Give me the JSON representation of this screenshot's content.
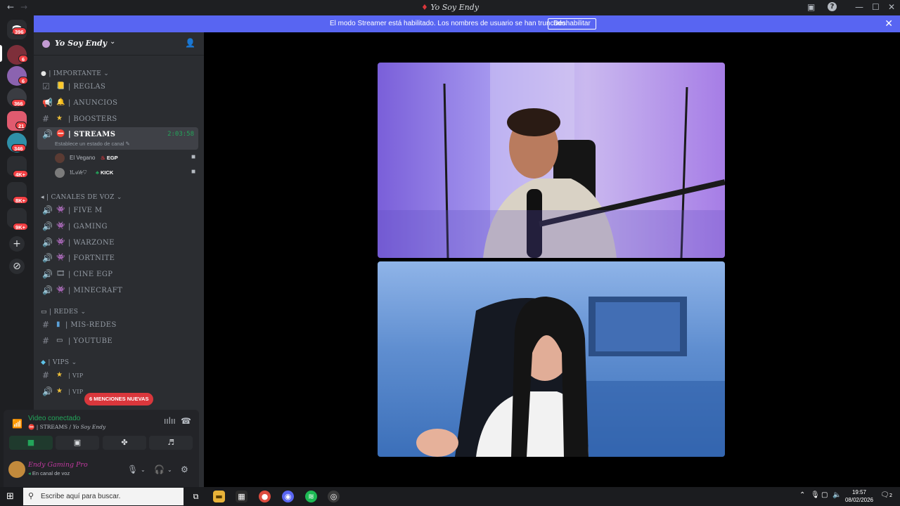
{
  "window": {
    "title": "Yo Soy Endy",
    "back_icon": "←",
    "forward_icon": "→",
    "minimize": "—",
    "maximize": "☐",
    "close": "✕",
    "help": "?"
  },
  "banner": {
    "message": "El modo Streamer está habilitado. Los nombres de usuario se han truncado.",
    "button": "Deshabilitar",
    "close": "✕"
  },
  "servers": {
    "badges": [
      "396",
      "6",
      "6",
      "366",
      "21",
      "346",
      "4K+",
      "8K+",
      "9K+"
    ],
    "add_icon": "+",
    "explore_icon": "⊘"
  },
  "guild": {
    "name": "Yo Soy Endy",
    "chevron": "⌄"
  },
  "categories": [
    {
      "label": "| IMPORTANTE",
      "chev": "⌄"
    },
    {
      "label": "| CANALES DE VOZ",
      "chev": "⌄"
    },
    {
      "label": "| REDES",
      "chev": "⌄"
    },
    {
      "label": "| VIPS",
      "chev": "⌄"
    }
  ],
  "channels": {
    "reglas": "| REGLAS",
    "anuncios": "| ANUNCIOS",
    "boosters": "| BOOSTERS",
    "streams": "| STREAMS",
    "streams_timer": "2:03:58",
    "streams_status": "Establece un estado de canal",
    "fivem": "| FIVE M",
    "gaming": "|  GAMING",
    "warzone": "| WARZONE",
    "fortnite": "| FORTNITE",
    "cine": "| CINE EGP",
    "minecraft": "| MINECRAFT",
    "misredes": "| MIS-REDES",
    "youtube": "| YOUTUBE",
    "vip1": "| VIP",
    "vip2": "| VIP"
  },
  "voice_users": [
    {
      "name": "El Vegano",
      "tag": "EGP"
    },
    {
      "name": "𝔘𝒜𝓁𝑒♡",
      "tag": "KICK"
    }
  ],
  "mentions_pill": "6 MENCIONES NUEVAS",
  "voice_panel": {
    "status": "Video conectado",
    "channel": "| STREAMS / ",
    "guild": "Yo Soy Endy"
  },
  "user": {
    "name": "Endy Gaming Pro",
    "sub": "En canal de voz"
  },
  "taskbar": {
    "search_placeholder": "Escribe aquí para buscar.",
    "time": "19:57",
    "date": "08/02/2026",
    "notif_count": "2"
  },
  "colors": {
    "accent": "#5865f2",
    "online": "#23a55a",
    "badge": "#f23f43"
  }
}
